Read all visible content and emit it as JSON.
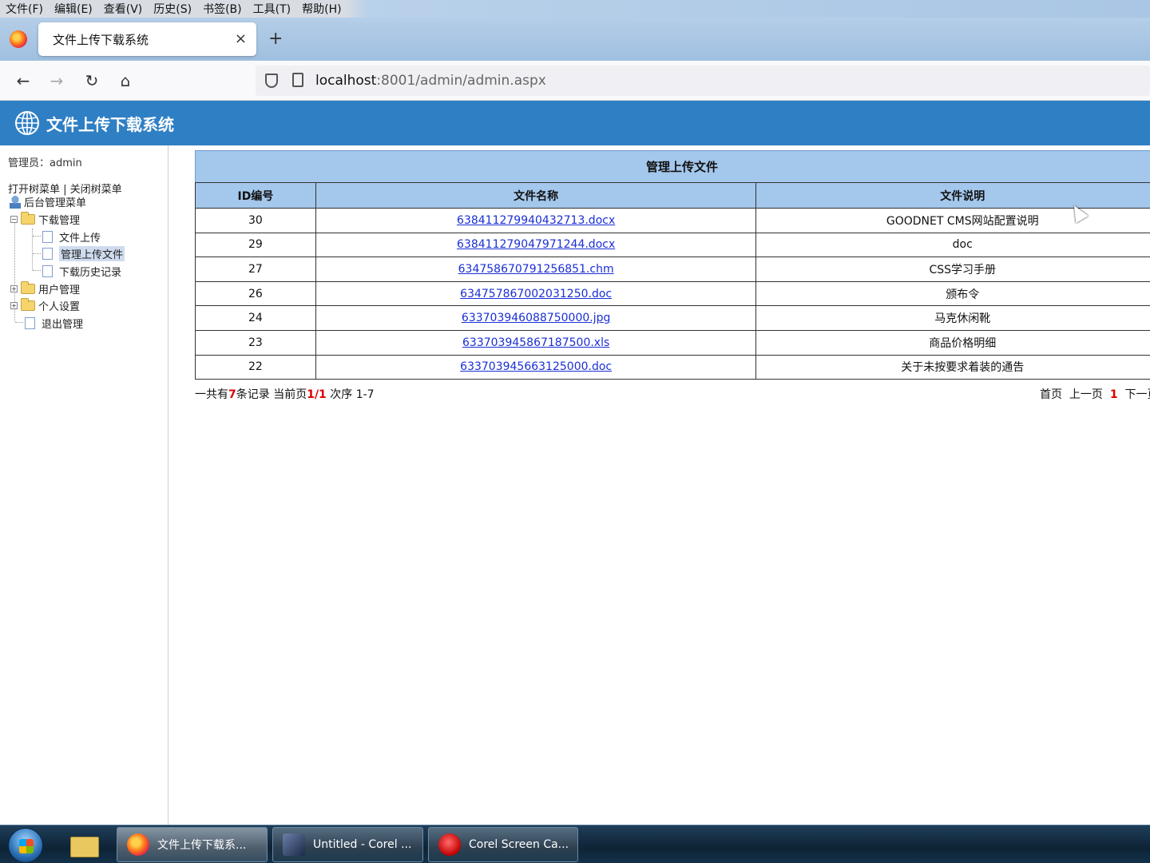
{
  "menu": [
    "文件(F)",
    "编辑(E)",
    "查看(V)",
    "历史(S)",
    "书签(B)",
    "工具(T)",
    "帮助(H)"
  ],
  "tab": {
    "title": "文件上传下载系统",
    "close": "×",
    "new": "+"
  },
  "nav": {
    "back": "←",
    "forward": "→",
    "reload": "↻",
    "home": "⌂"
  },
  "url": {
    "host": "localhost",
    "rest": ":8001/admin/admin.aspx"
  },
  "header": {
    "title": "文件上传下载系统"
  },
  "sidebar": {
    "admin_label": "管理员：admin",
    "open_tree": "打开树菜单",
    "separator": " | ",
    "close_tree": "关闭树菜单",
    "root": "后台管理菜单",
    "download_mgmt": "下载管理",
    "file_upload": "文件上传",
    "manage_uploads": "管理上传文件",
    "download_history": "下载历史记录",
    "user_mgmt": "用户管理",
    "personal_settings": "个人设置",
    "logout": "退出管理"
  },
  "table": {
    "caption": "管理上传文件",
    "headers": [
      "ID编号",
      "文件名称",
      "文件说明"
    ],
    "rows": [
      {
        "id": "30",
        "name": "638411279940432713.docx",
        "desc": "GOODNET CMS网站配置说明"
      },
      {
        "id": "29",
        "name": "638411279047971244.docx",
        "desc": "doc"
      },
      {
        "id": "27",
        "name": "634758670791256851.chm",
        "desc": "CSS学习手册"
      },
      {
        "id": "26",
        "name": "634757867002031250.doc",
        "desc": "颁布令"
      },
      {
        "id": "24",
        "name": "633703946088750000.jpg",
        "desc": "马克休闲靴"
      },
      {
        "id": "23",
        "name": "633703945867187500.xls",
        "desc": "商品价格明细"
      },
      {
        "id": "22",
        "name": "633703945663125000.doc",
        "desc": "关于未按要求着装的通告"
      }
    ]
  },
  "pager": {
    "t1": "一共有",
    "count": "7",
    "t2": "条记录 当前页",
    "page": "1/1",
    "t3": " 次序 1-7",
    "first": "首页",
    "prev": "上一页",
    "current": "1",
    "next": "下一页"
  },
  "taskbar": {
    "items": [
      "文件上传下载系...",
      "Untitled - Corel ...",
      "Corel Screen Ca..."
    ]
  }
}
